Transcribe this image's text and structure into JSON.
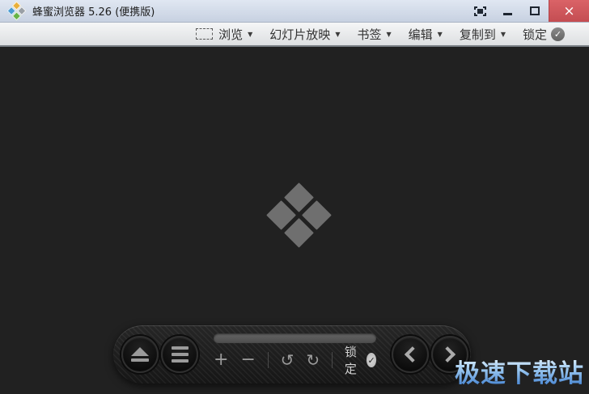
{
  "window": {
    "title": "蜂蜜浏览器 5.26 (便携版)"
  },
  "glyphs": {
    "close": "×",
    "caret": "▼",
    "check": "✓",
    "rotate_left": "↺",
    "rotate_right": "↻",
    "zoom_in": "+",
    "zoom_out": "−"
  },
  "menubar": {
    "items": [
      {
        "label": "浏览"
      },
      {
        "label": "幻灯片放映"
      },
      {
        "label": "书签"
      },
      {
        "label": "编辑"
      },
      {
        "label": "复制到"
      },
      {
        "label": "锁定"
      }
    ]
  },
  "toolbar": {
    "lock_label": "锁定"
  },
  "watermark": {
    "text": "极速下载站"
  },
  "colors": {
    "close_button": "#c9565b",
    "content_bg": "#212121",
    "logo_blue": "#4b9cd3",
    "logo_green": "#67b346",
    "logo_yellow": "#e9b03c",
    "logo_gray": "#9aa0a6",
    "center_logo_gray": "#6f6f6f"
  }
}
